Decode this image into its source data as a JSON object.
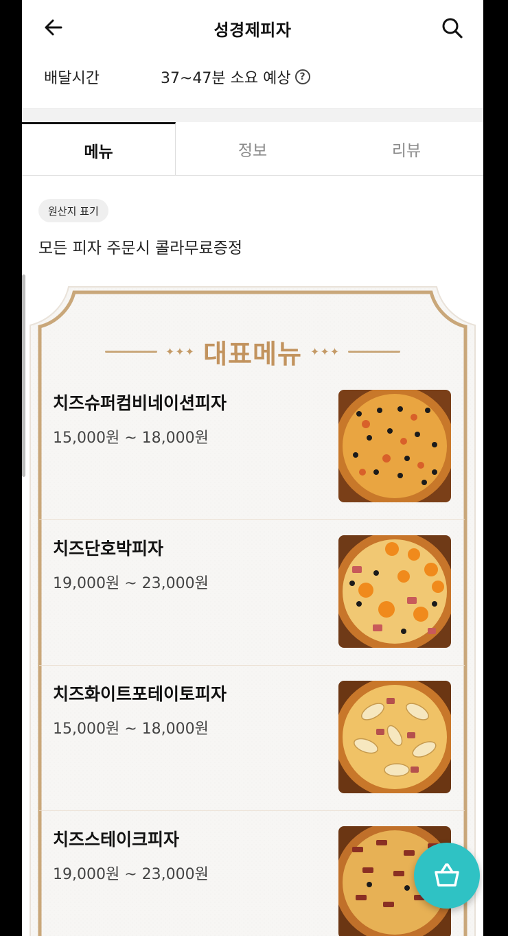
{
  "header": {
    "title": "성경제피자",
    "back_icon": "arrow-left-icon",
    "search_icon": "search-icon"
  },
  "delivery": {
    "label": "배달시간",
    "value": "37~47분 소요 예상",
    "help_glyph": "?"
  },
  "tabs": [
    {
      "label": "메뉴",
      "active": true
    },
    {
      "label": "정보",
      "active": false
    },
    {
      "label": "리뷰",
      "active": false
    }
  ],
  "origin_chip": "원산지 표기",
  "promo_text": "모든 피자 주문시 콜라무료증정",
  "featured": {
    "heading": "대표메뉴",
    "sparkle_left": "✦✦✦",
    "sparkle_right": "✦✦✦",
    "items": [
      {
        "name": "치즈슈퍼컴비네이션피자",
        "price": "15,000원 ~ 18,000원"
      },
      {
        "name": "치즈단호박피자",
        "price": "19,000원 ~ 23,000원"
      },
      {
        "name": "치즈화이트포테이토피자",
        "price": "15,000원 ~ 18,000원"
      },
      {
        "name": "치즈스테이크피자",
        "price": "19,000원 ~ 23,000원"
      }
    ]
  },
  "colors": {
    "accent_gold": "#c2935e",
    "frame_border": "#c9a77a",
    "fab": "#2fc2c4"
  },
  "fab_icon": "basket-icon"
}
